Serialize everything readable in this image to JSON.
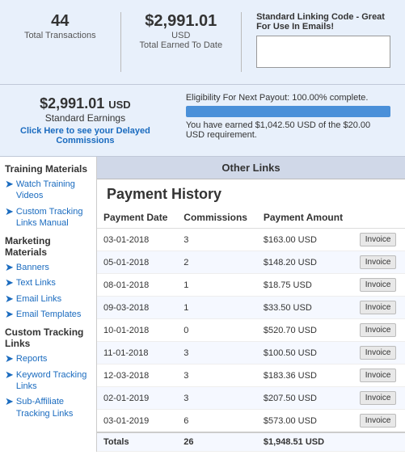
{
  "topStats": {
    "transactions": {
      "count": "44",
      "label": "Total Transactions"
    },
    "earned": {
      "amount": "$2,991.01",
      "currency": "USD",
      "label": "Total Earned To Date"
    }
  },
  "linkingCode": {
    "title": "Standard Linking Code - Great For Use In Emails!",
    "placeholder": "",
    "inputValue": ""
  },
  "secondStats": {
    "standardEarnings": {
      "amount": "$2,991.01",
      "currency": "USD",
      "label": "Standard Earnings",
      "linkText": "Click Here to see your Delayed Commissions"
    },
    "payout": {
      "eligibilityText": "Eligibility For Next Payout: 100.00% complete.",
      "barPercent": 100,
      "earnedText": "You have earned $1,042.50 USD of the $20.00 USD requirement."
    }
  },
  "sidebar": {
    "trainingTitle": "Training Materials",
    "trainingItems": [
      {
        "id": "watch-training",
        "text": "Watch Training Videos"
      },
      {
        "id": "custom-tracking-links-manual",
        "text": "Custom Tracking Links Manual"
      }
    ],
    "marketingTitle": "Marketing Materials",
    "marketingItems": [
      {
        "id": "banners",
        "text": "Banners"
      },
      {
        "id": "text-links",
        "text": "Text Links"
      },
      {
        "id": "email-links",
        "text": "Email Links"
      },
      {
        "id": "email-templates",
        "text": "Email Templates"
      }
    ],
    "customTrackingTitle": "Custom Tracking Links",
    "customTrackingItems": [
      {
        "id": "reports",
        "text": "Reports"
      },
      {
        "id": "keyword-tracking-links",
        "text": "Keyword Tracking Links"
      },
      {
        "id": "sub-affiliate-tracking-links",
        "text": "Sub-Affiliate Tracking Links"
      }
    ]
  },
  "otherLinks": {
    "headerText": "Other Links"
  },
  "paymentHistory": {
    "title": "Payment History",
    "columns": [
      "Payment Date",
      "Commissions",
      "Payment Amount"
    ],
    "rows": [
      {
        "date": "03-01-2018",
        "commissions": "3",
        "amount": "$163.00 USD"
      },
      {
        "date": "05-01-2018",
        "commissions": "2",
        "amount": "$148.20 USD"
      },
      {
        "date": "08-01-2018",
        "commissions": "1",
        "amount": "$18.75 USD"
      },
      {
        "date": "09-03-2018",
        "commissions": "1",
        "amount": "$33.50 USD"
      },
      {
        "date": "10-01-2018",
        "commissions": "0",
        "amount": "$520.70 USD"
      },
      {
        "date": "11-01-2018",
        "commissions": "3",
        "amount": "$100.50 USD"
      },
      {
        "date": "12-03-2018",
        "commissions": "3",
        "amount": "$183.36 USD"
      },
      {
        "date": "02-01-2019",
        "commissions": "3",
        "amount": "$207.50 USD"
      },
      {
        "date": "03-01-2019",
        "commissions": "6",
        "amount": "$573.00 USD"
      }
    ],
    "totals": {
      "label": "Totals",
      "commissions": "26",
      "amount": "$1,948.51 USD"
    },
    "invoiceButtonLabel": "Invoice"
  }
}
